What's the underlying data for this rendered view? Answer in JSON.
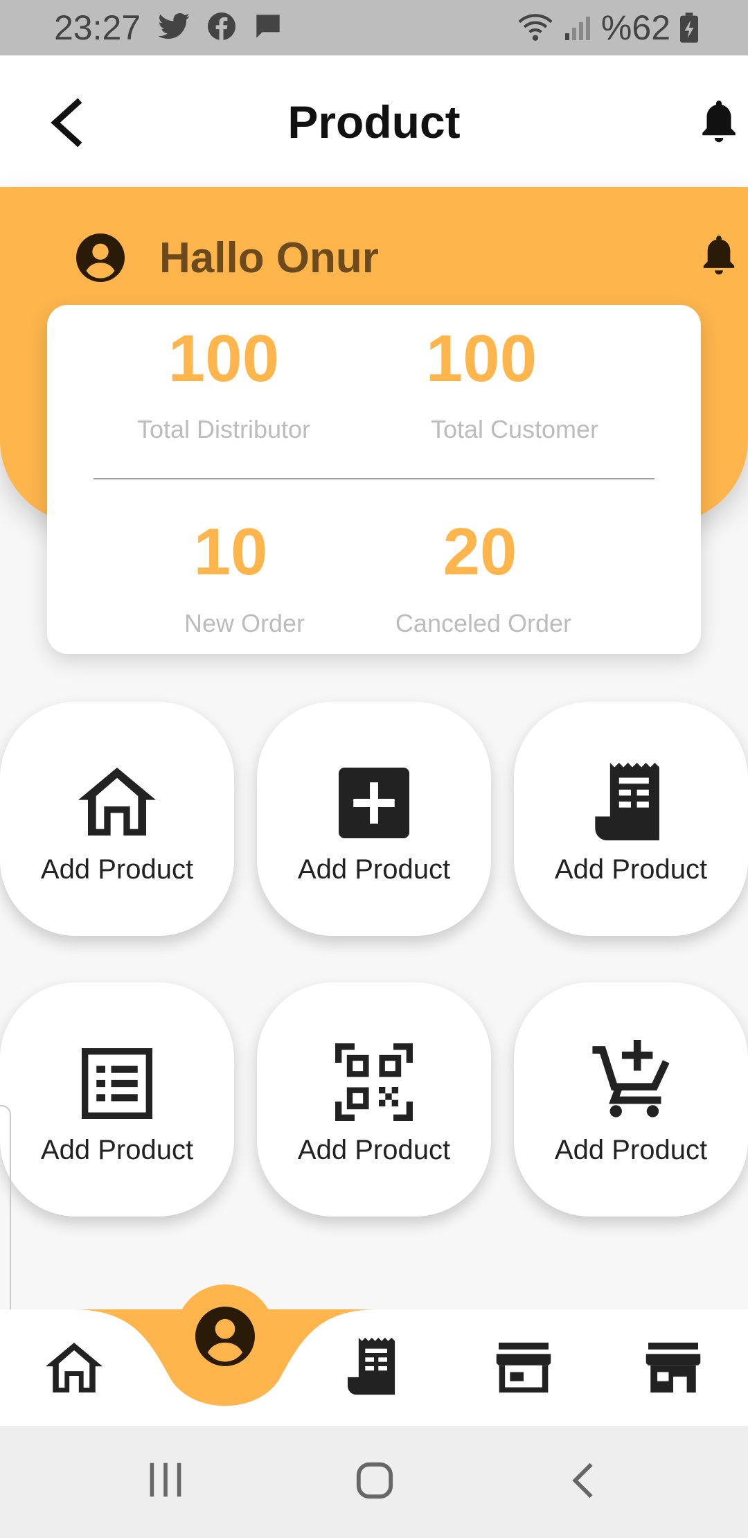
{
  "status_bar": {
    "time": "23:27",
    "battery_text": "%62"
  },
  "app_bar": {
    "title": "Product"
  },
  "header": {
    "greeting": "Hallo Onur"
  },
  "stats": [
    {
      "value": "100",
      "label": "Total Distributor"
    },
    {
      "value": "100",
      "label": "Total Customer"
    },
    {
      "value": "10",
      "label": "New Order"
    },
    {
      "value": "20",
      "label": "Canceled Order"
    }
  ],
  "tiles": [
    {
      "label": "Add Product",
      "icon": "home-icon"
    },
    {
      "label": "Add Product",
      "icon": "add-box-icon"
    },
    {
      "label": "Add Product",
      "icon": "receipt-icon"
    },
    {
      "label": "Add Product",
      "icon": "list-icon"
    },
    {
      "label": "Add Product",
      "icon": "qr-code-icon"
    },
    {
      "label": "Add Product",
      "icon": "add-cart-icon"
    }
  ],
  "bottom_nav": [
    "home-icon",
    "account-icon",
    "receipt-icon",
    "store-outline-icon",
    "store-icon"
  ],
  "colors": {
    "accent": "#fdb54c",
    "greeting": "#6b4a1e",
    "stat_label": "#bcbcbc"
  }
}
